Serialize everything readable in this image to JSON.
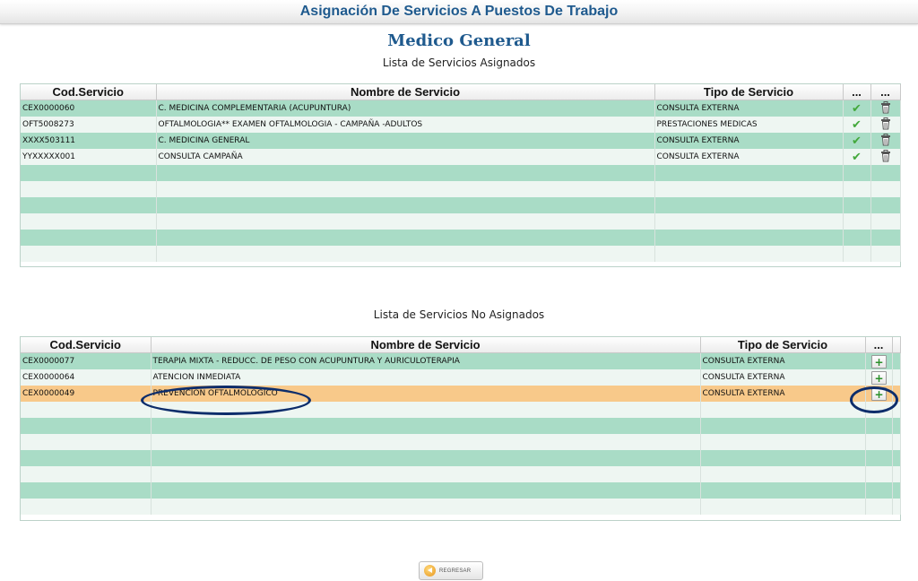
{
  "window": {
    "title": "Asignación De Servicios A Puestos De Trabajo"
  },
  "profile": {
    "name": "Medico General"
  },
  "assigned": {
    "caption": "Lista de Servicios Asignados",
    "headers": [
      "Cod.Servicio",
      "Nombre de Servicio",
      "Tipo de Servicio",
      "...",
      "..."
    ],
    "rows": [
      {
        "code": "CEX0000060",
        "name": "C. MEDICINA COMPLEMENTARIA (ACUPUNTURA)",
        "type": "CONSULTA EXTERNA"
      },
      {
        "code": "OFT5008273",
        "name": "OFTALMOLOGIA** EXAMEN OFTALMOLOGIA - CAMPAÑA -ADULTOS",
        "type": "PRESTACIONES MEDICAS"
      },
      {
        "code": "XXXX503111",
        "name": "C. MEDICINA GENERAL",
        "type": "CONSULTA EXTERNA"
      },
      {
        "code": "YYXXXXX001",
        "name": "CONSULTA CAMPAÑA",
        "type": "CONSULTA EXTERNA"
      }
    ],
    "row_icons": [
      "check-icon",
      "trash-icon"
    ]
  },
  "unassigned": {
    "caption": "Lista de Servicios No Asignados",
    "headers": [
      "Cod.Servicio",
      "Nombre de Servicio",
      "Tipo de Servicio",
      "..."
    ],
    "rows": [
      {
        "code": "CEX0000077",
        "name": "TERAPIA MIXTA - REDUCC. DE PESO CON ACUPUNTURA Y AURICULOTERAPIA",
        "type": "CONSULTA EXTERNA"
      },
      {
        "code": "CEX0000064",
        "name": "ATENCION INMEDIATA",
        "type": "CONSULTA EXTERNA"
      },
      {
        "code": "CEX0000049",
        "name": "PREVENCION OFTALMOLOGICO",
        "type": "CONSULTA EXTERNA",
        "selected": true
      }
    ],
    "row_icons": [
      "add-icon"
    ]
  },
  "footer": {
    "back_label": "REGRESAR"
  },
  "colors": {
    "title": "#1f5a8e",
    "row_even": "#a9dcc6",
    "row_odd": "#eef6f2",
    "row_selected": "#f8c98a",
    "annotation_oval": "#0d2d6b"
  }
}
